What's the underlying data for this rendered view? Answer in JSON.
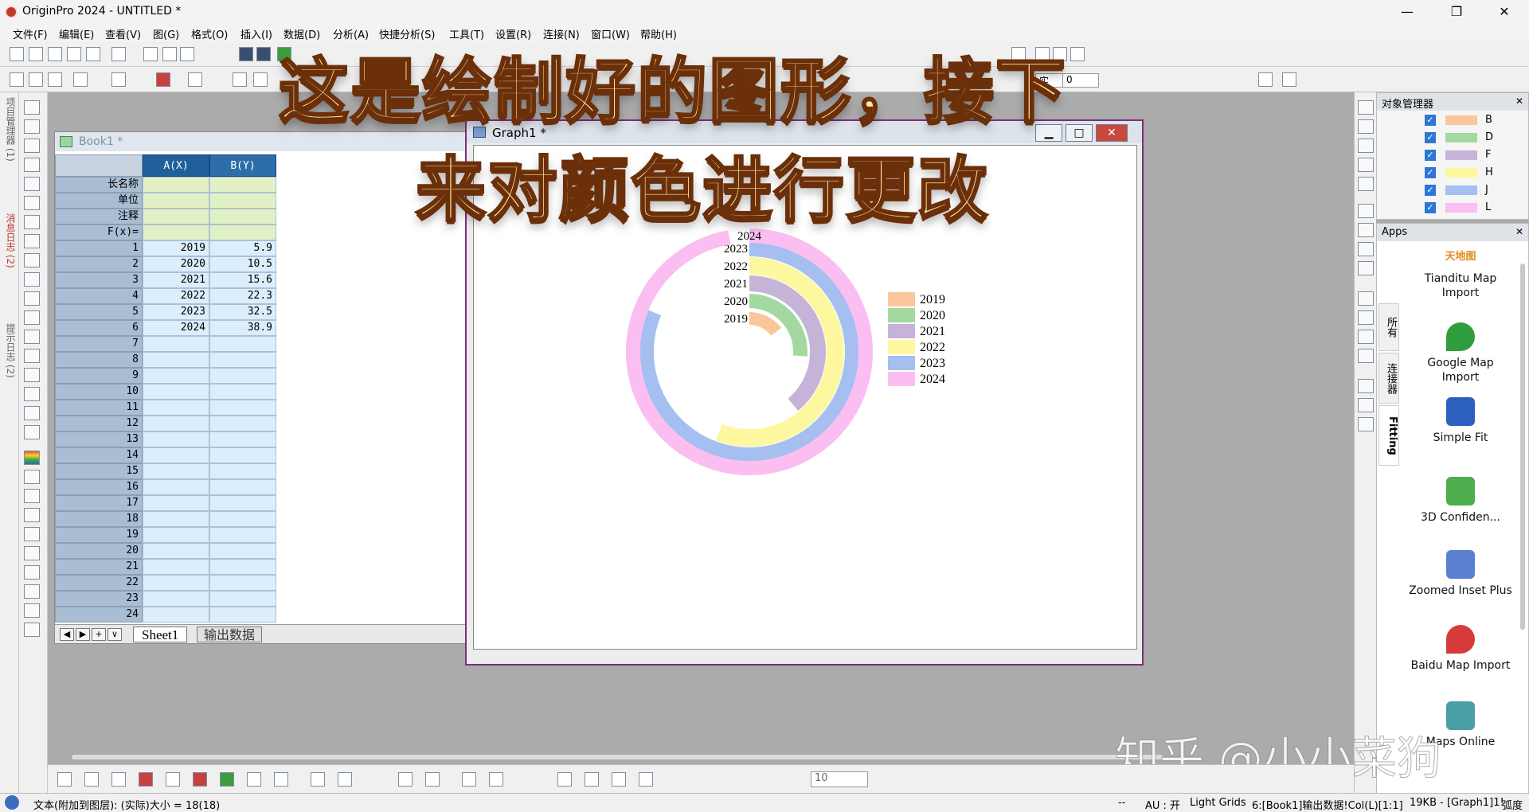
{
  "window": {
    "title": "OriginPro 2024 - UNTITLED *",
    "min": "—",
    "max": "❐",
    "close": "✕"
  },
  "menu": [
    "文件(F)",
    "编辑(E)",
    "查看(V)",
    "图(G)",
    "格式(O)",
    "插入(I)",
    "数据(D)",
    "分析(A)",
    "快捷分析(S)",
    "工具(T)",
    "设置(R)",
    "连接(N)",
    "窗口(W)",
    "帮助(H)"
  ],
  "left_sidebar": {
    "tab1": "项目管理器 (1)",
    "tab2": "消息日志 (2)",
    "tab3": "提示日志 (2)"
  },
  "book1": {
    "title": "Book1 *",
    "columns": [
      {
        "label": "A(X)"
      },
      {
        "label": "B(Y)"
      }
    ],
    "meta_rows": [
      "长名称",
      "单位",
      "注释",
      "F(x)="
    ],
    "rows": [
      {
        "n": "1",
        "a": "2019",
        "b": "5.9"
      },
      {
        "n": "2",
        "a": "2020",
        "b": "10.5"
      },
      {
        "n": "3",
        "a": "2021",
        "b": "15.6"
      },
      {
        "n": "4",
        "a": "2022",
        "b": "22.3"
      },
      {
        "n": "5",
        "a": "2023",
        "b": "32.5"
      },
      {
        "n": "6",
        "a": "2024",
        "b": "38.9"
      },
      {
        "n": "7",
        "a": "",
        "b": ""
      },
      {
        "n": "8",
        "a": "",
        "b": ""
      },
      {
        "n": "9",
        "a": "",
        "b": ""
      },
      {
        "n": "10",
        "a": "",
        "b": ""
      },
      {
        "n": "11",
        "a": "",
        "b": ""
      },
      {
        "n": "12",
        "a": "",
        "b": ""
      },
      {
        "n": "13",
        "a": "",
        "b": ""
      },
      {
        "n": "14",
        "a": "",
        "b": ""
      },
      {
        "n": "15",
        "a": "",
        "b": ""
      },
      {
        "n": "16",
        "a": "",
        "b": ""
      },
      {
        "n": "17",
        "a": "",
        "b": ""
      },
      {
        "n": "18",
        "a": "",
        "b": ""
      },
      {
        "n": "19",
        "a": "",
        "b": ""
      },
      {
        "n": "20",
        "a": "",
        "b": ""
      },
      {
        "n": "21",
        "a": "",
        "b": ""
      },
      {
        "n": "22",
        "a": "",
        "b": ""
      },
      {
        "n": "23",
        "a": "",
        "b": ""
      },
      {
        "n": "24",
        "a": "",
        "b": ""
      }
    ],
    "sheet_nav": [
      "◀",
      "▶",
      "+",
      "∨"
    ],
    "sheet_tabs": [
      "Sheet1",
      "输出数据"
    ]
  },
  "graph1": {
    "title": "Graph1 *",
    "min": "▁",
    "max": "□",
    "close": "✕"
  },
  "chart_data": {
    "type": "radial-bar",
    "categories": [
      "2019",
      "2020",
      "2021",
      "2022",
      "2023",
      "2024"
    ],
    "values": [
      5.9,
      10.5,
      15.6,
      22.3,
      32.5,
      38.9
    ],
    "max_value": 40,
    "colors": [
      "#f9c79a",
      "#a3d9a0",
      "#c6b4d8",
      "#fdf8a0",
      "#a4bff0",
      "#fbbef0"
    ],
    "legend": [
      "2019",
      "2020",
      "2021",
      "2022",
      "2023",
      "2024"
    ],
    "legend_position": "right",
    "start": "top",
    "direction": "clockwise"
  },
  "overlay_caption": {
    "line1": "这是绘制好的图形，接下",
    "line2": "来对颜色进行更改"
  },
  "object_manager": {
    "title": "对象管理器",
    "items": [
      {
        "label": "B",
        "color": "#f9c79a"
      },
      {
        "label": "D",
        "color": "#a3d9a0"
      },
      {
        "label": "F",
        "color": "#c6b4d8"
      },
      {
        "label": "H",
        "color": "#fdf8a0"
      },
      {
        "label": "J",
        "color": "#a4bff0"
      },
      {
        "label": "L",
        "color": "#fbbef0"
      }
    ]
  },
  "apps": {
    "title": "Apps",
    "tabs": [
      "所有",
      "连接器",
      "Fitting"
    ],
    "items": [
      {
        "name": "Tianditu Map Import",
        "logo_text": "天地图"
      },
      {
        "name": "Google Map Import"
      },
      {
        "name": "Simple Fit"
      },
      {
        "name": "3D Confiden..."
      },
      {
        "name": "Zoomed Inset Plus"
      },
      {
        "name": "Baidu Map Import"
      },
      {
        "name": "Maps Online"
      }
    ]
  },
  "toolbar2": {
    "font_size": "0",
    "font_label": "实"
  },
  "bottom_toolbar": {
    "zoom_value": "10"
  },
  "statusbar": {
    "left": "文本(附加到图层): (实际)大小 = 18(18)",
    "au": "AU : 开",
    "grids": "Light Grids",
    "source": "6:[Book1]输出数据!Col(L)[1:1]",
    "size": "19KB - [Graph1]1!",
    "unit": "弧度",
    "sep": "--"
  },
  "watermark": "知乎 @小小菜狗"
}
